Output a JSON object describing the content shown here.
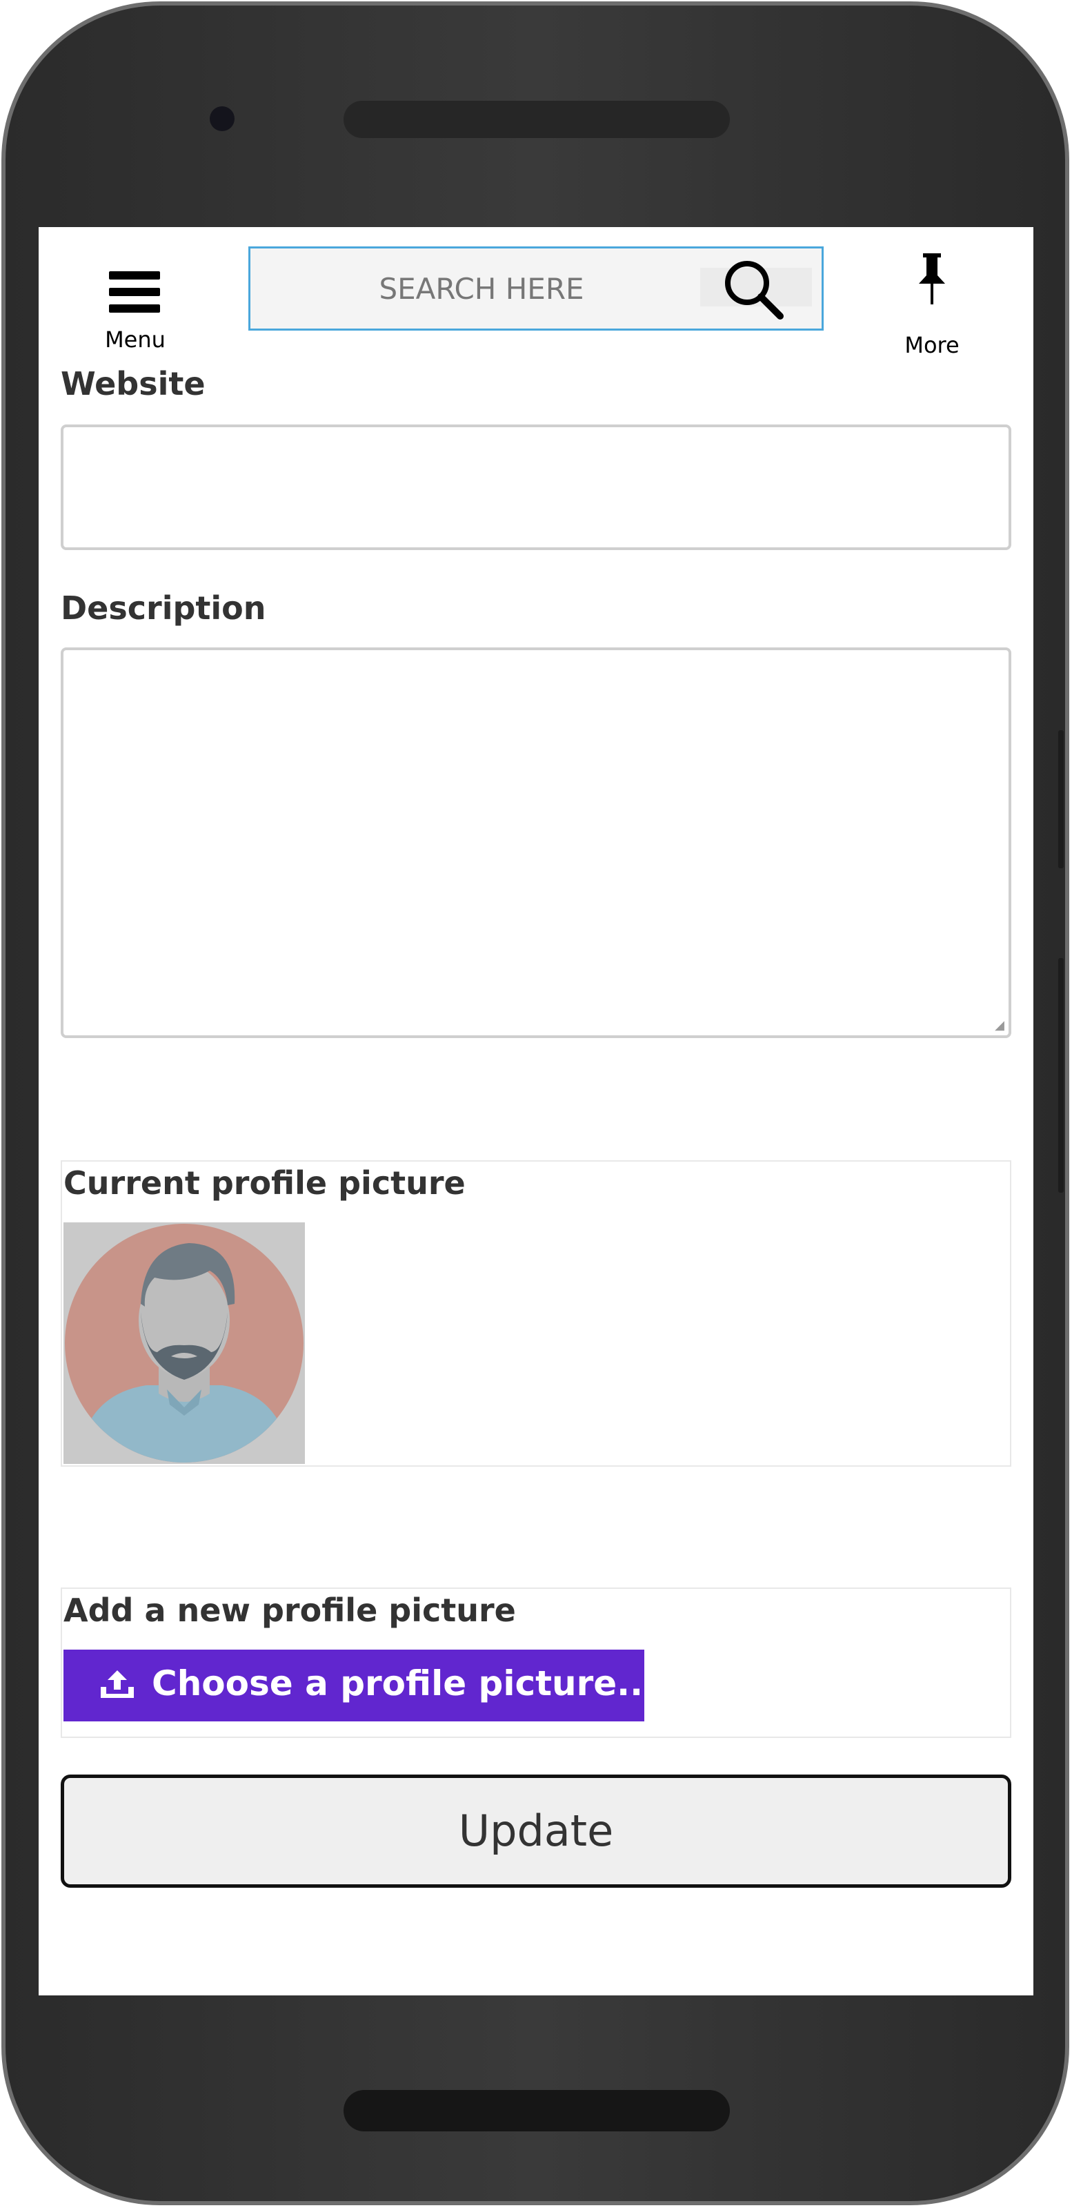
{
  "header": {
    "menu_label": "Menu",
    "search_placeholder": "SEARCH HERE",
    "more_label": "More"
  },
  "form": {
    "website_label": "Website",
    "website_value": "",
    "description_label": "Description",
    "description_value": "",
    "current_picture_label": "Current profile picture",
    "new_picture_label": "Add a new profile picture",
    "choose_picture_button": "Choose a profile picture...",
    "update_button": "Update"
  },
  "icons": {
    "menu": "hamburger-icon",
    "search": "magnifier-icon",
    "more": "pin-icon",
    "upload": "upload-icon",
    "avatar": "user-avatar"
  },
  "colors": {
    "accent": "#6126cf",
    "search_border": "#4aa7dc"
  }
}
